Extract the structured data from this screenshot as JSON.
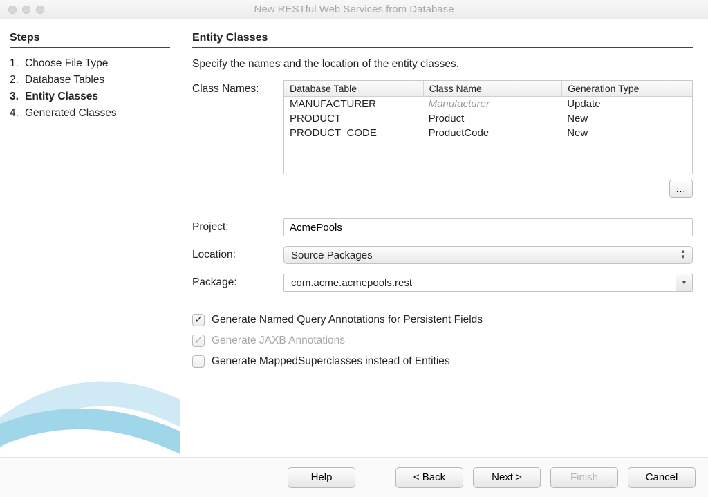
{
  "window": {
    "title": "New RESTful Web Services from Database"
  },
  "sidebar": {
    "heading": "Steps",
    "steps": [
      {
        "num": "1.",
        "label": "Choose File Type",
        "current": false
      },
      {
        "num": "2.",
        "label": "Database Tables",
        "current": false
      },
      {
        "num": "3.",
        "label": "Entity Classes",
        "current": true
      },
      {
        "num": "4.",
        "label": "Generated Classes",
        "current": false
      }
    ]
  },
  "main": {
    "heading": "Entity Classes",
    "instruction": "Specify the names and the location of the entity classes.",
    "classNamesLabel": "Class Names:",
    "table": {
      "headers": {
        "db": "Database Table",
        "cn": "Class Name",
        "gt": "Generation Type"
      },
      "rows": [
        {
          "db": "MANUFACTURER",
          "cn": "Manufacturer",
          "gt": "Update",
          "cnGray": true
        },
        {
          "db": "PRODUCT",
          "cn": "Product",
          "gt": "New",
          "cnGray": false
        },
        {
          "db": "PRODUCT_CODE",
          "cn": "ProductCode",
          "gt": "New",
          "cnGray": false
        }
      ]
    },
    "browseLabel": "...",
    "projectLabel": "Project:",
    "projectValue": "AcmePools",
    "locationLabel": "Location:",
    "locationValue": "Source Packages",
    "packageLabel": "Package:",
    "packageValue": "com.acme.acmepools.rest",
    "checks": {
      "namedQuery": "Generate Named Query Annotations for Persistent Fields",
      "jaxb": "Generate JAXB Annotations",
      "mapped": "Generate MappedSuperclasses instead of Entities"
    }
  },
  "footer": {
    "help": "Help",
    "back": "< Back",
    "next": "Next >",
    "finish": "Finish",
    "cancel": "Cancel"
  }
}
